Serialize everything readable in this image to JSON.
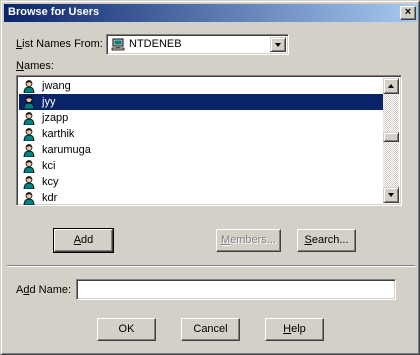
{
  "window": {
    "title": "Browse for Users",
    "close_glyph": "×"
  },
  "list_names_from": {
    "label_pre": "",
    "label_mnemonic": "L",
    "label_post": "ist Names From:",
    "value": "NTDENEB",
    "icon": "network-computer-icon"
  },
  "names": {
    "label_mnemonic": "N",
    "label_post": "ames:",
    "items": [
      {
        "label": "jwang",
        "icon": "user-icon",
        "selected": false
      },
      {
        "label": "jyy",
        "icon": "user-icon",
        "selected": true
      },
      {
        "label": "jzapp",
        "icon": "user-icon",
        "selected": false
      },
      {
        "label": "karthik",
        "icon": "user-icon",
        "selected": false
      },
      {
        "label": "karumuga",
        "icon": "user-icon",
        "selected": false
      },
      {
        "label": "kci",
        "icon": "user-icon",
        "selected": false
      },
      {
        "label": "kcy",
        "icon": "user-icon",
        "selected": false
      },
      {
        "label": "kdr",
        "icon": "user-icon",
        "selected": false
      }
    ]
  },
  "buttons": {
    "add": {
      "mnemonic": "A",
      "rest": "dd"
    },
    "members": {
      "mnemonic": "M",
      "rest": "embers..."
    },
    "search": {
      "mnemonic": "S",
      "rest": "earch..."
    },
    "ok": "OK",
    "cancel": "Cancel",
    "help": {
      "mnemonic": "H",
      "rest": "elp"
    }
  },
  "add_name": {
    "pre": "A",
    "mnemonic": "d",
    "post": "d Name:",
    "value": ""
  },
  "colors": {
    "selection": "#0a246a",
    "title_gradient_start": "#0a246a",
    "title_gradient_end": "#a6caf0",
    "face": "#d4d0c8"
  }
}
